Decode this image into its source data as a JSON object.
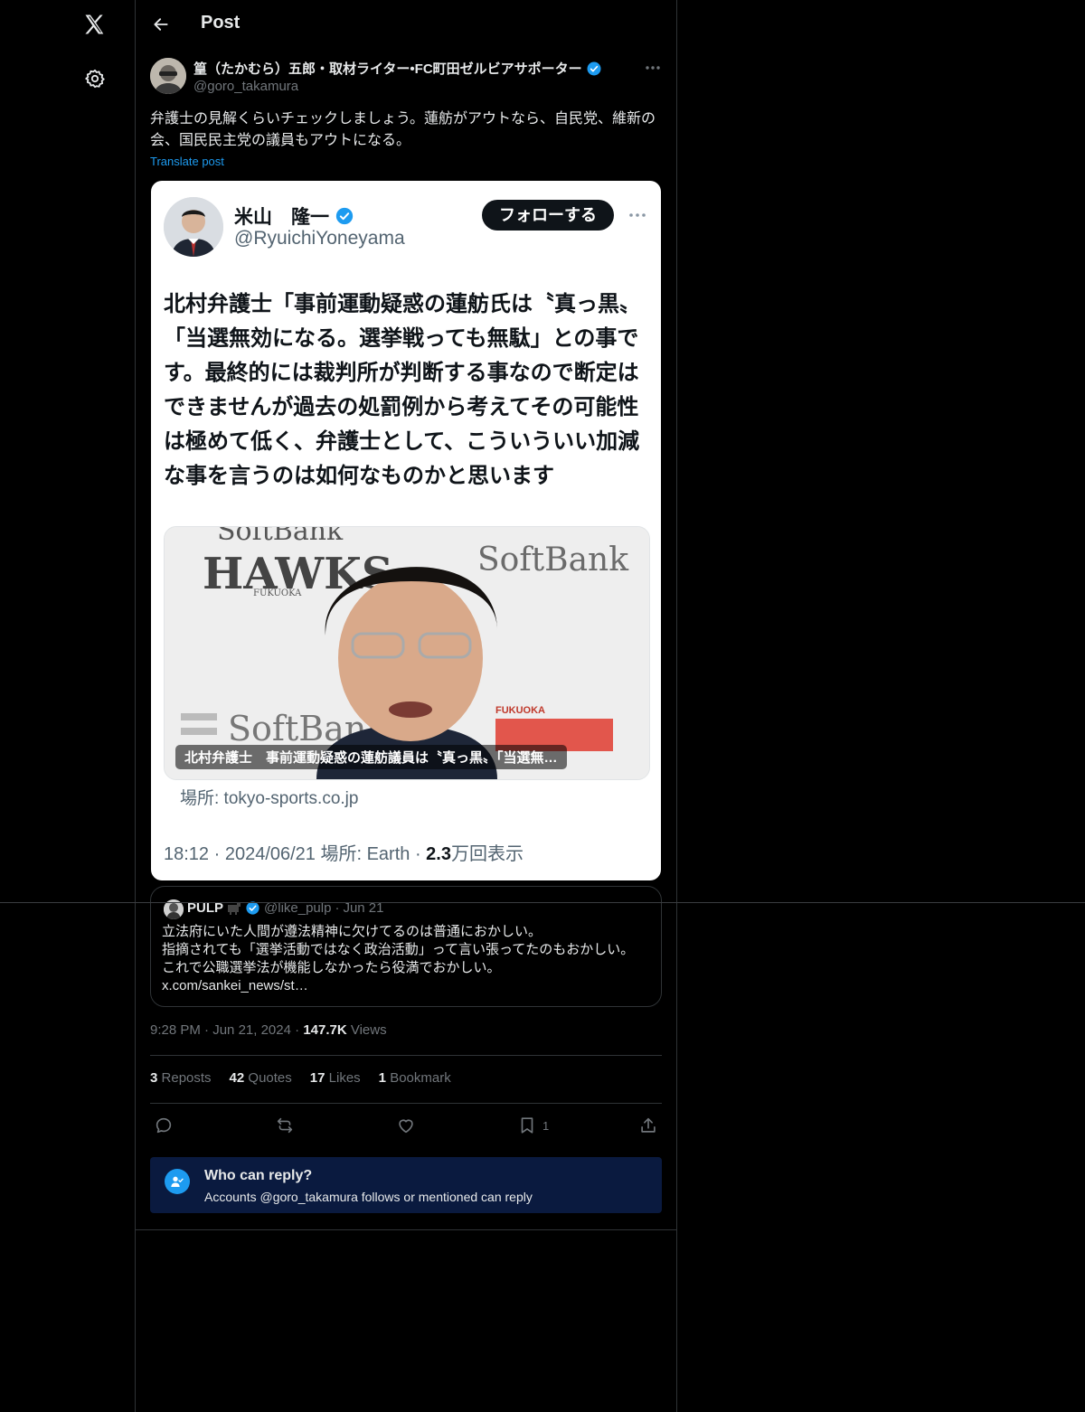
{
  "nav": {
    "logo_icon": "x-logo-icon",
    "settings_icon": "gear-icon"
  },
  "header": {
    "title": "Post",
    "back_icon": "arrow-left-icon"
  },
  "post": {
    "author_name": "篁（たかむら）五郎・取材ライター•FC町田ゼルビアサポーター",
    "author_handle": "@goro_takamura",
    "verified": true,
    "text": "弁護士の見解くらいチェックしましょう。蓮舫がアウトなら、自民党、維新の会、国民民主党の議員もアウトになる。",
    "translate_label": "Translate post",
    "timestamp_time": "9:28 PM",
    "timestamp_date": "Jun 21, 2024",
    "views_count": "147.7K",
    "views_label": "Views"
  },
  "embedded_screenshot": {
    "name": "米山　隆一",
    "handle": "@RyuichiYoneyama",
    "follow_label": "フォローする",
    "body": "北村弁護士「事前運動疑惑の蓮舫氏は〝真っ黒〟「当選無効になる。選挙戦っても無駄」との事です。最終的には裁判所が判断する事なので断定はできませんが過去の処罰例から考えてその可能性は極めて低く、弁護士として、こういういい加減な事を言うのは如何なものかと思います",
    "image_caption": "北村弁護士　事前運動疑惑の蓮舫議員は〝真っ黒〟「当選無…",
    "image_text_1": "SoftBank",
    "image_text_2": "HAWKS",
    "image_text_3": "FUKUOKA",
    "image_text_4": "FUKUOKA",
    "source": "場所: tokyo-sports.co.jp",
    "meta_prefix": "18:12 · 2024/06/21 場所: Earth · ",
    "meta_views_num": "2.3",
    "meta_views_suffix": "万回表示"
  },
  "quote": {
    "name": "PULP",
    "handle": "@like_pulp",
    "dot": "·",
    "date": "Jun 21",
    "lines": [
      "立法府にいた人間が遵法精神に欠けてるのは普通におかしい。",
      "指摘されても「選挙活動ではなく政治活動」って言い張ってたのもおかしい。",
      "これで公職選挙法が機能しなかったら役満でおかしい。",
      "x.com/sankei_news/st…"
    ]
  },
  "stats": {
    "reposts_count": "3",
    "reposts_label": "Reposts",
    "quotes_count": "42",
    "quotes_label": "Quotes",
    "likes_count": "17",
    "likes_label": "Likes",
    "bookmarks_count": "1",
    "bookmarks_label": "Bookmark"
  },
  "actions": {
    "bookmark_count": "1"
  },
  "reply_banner": {
    "title": "Who can reply?",
    "subtitle": "Accounts @goro_takamura follows or mentioned can reply"
  },
  "colors": {
    "background": "#000000",
    "accent": "#1d9bf0",
    "border": "#2f3336",
    "muted": "#71767b",
    "banner": "#0a1a3f"
  }
}
